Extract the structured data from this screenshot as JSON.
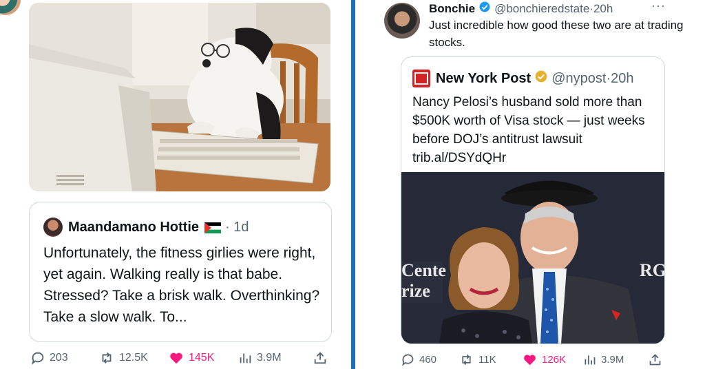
{
  "left_post": {
    "quote": {
      "author": "Maandamano Hottie",
      "time": "1d",
      "text": "Unfortunately, the fitness girlies were right, yet again. Walking really is that babe. Stressed? Take a brisk walk. Overthinking? Take a slow walk. To..."
    },
    "stats": {
      "replies": "203",
      "reposts": "12.5K",
      "likes": "145K",
      "views": "3.9M"
    }
  },
  "right_post": {
    "author": "Bonchie",
    "handle": "@bonchieredstate",
    "time": "20h",
    "more": "···",
    "text": "Just incredible how good these two are at trading stocks.",
    "quote": {
      "author": "New York Post",
      "handle": "@nypost",
      "time": "20h",
      "text": "Nancy Pelosi’s husband sold more than $500K worth of Visa stock — just weeks before DOJ’s antitrust lawsuit trib.al/DSYdQHr",
      "image_text_left": "Cente\nrize",
      "image_text_right": "RG"
    },
    "stats": {
      "replies": "460",
      "reposts": "11K",
      "likes": "126K",
      "views": "3.9M"
    }
  },
  "colors": {
    "divider": "#1d6fb8",
    "like": "#f91880",
    "muted": "#536471",
    "verified": "#1d9bf0",
    "verified_gold": "#e8b02c",
    "nyp_red": "#d32323"
  }
}
